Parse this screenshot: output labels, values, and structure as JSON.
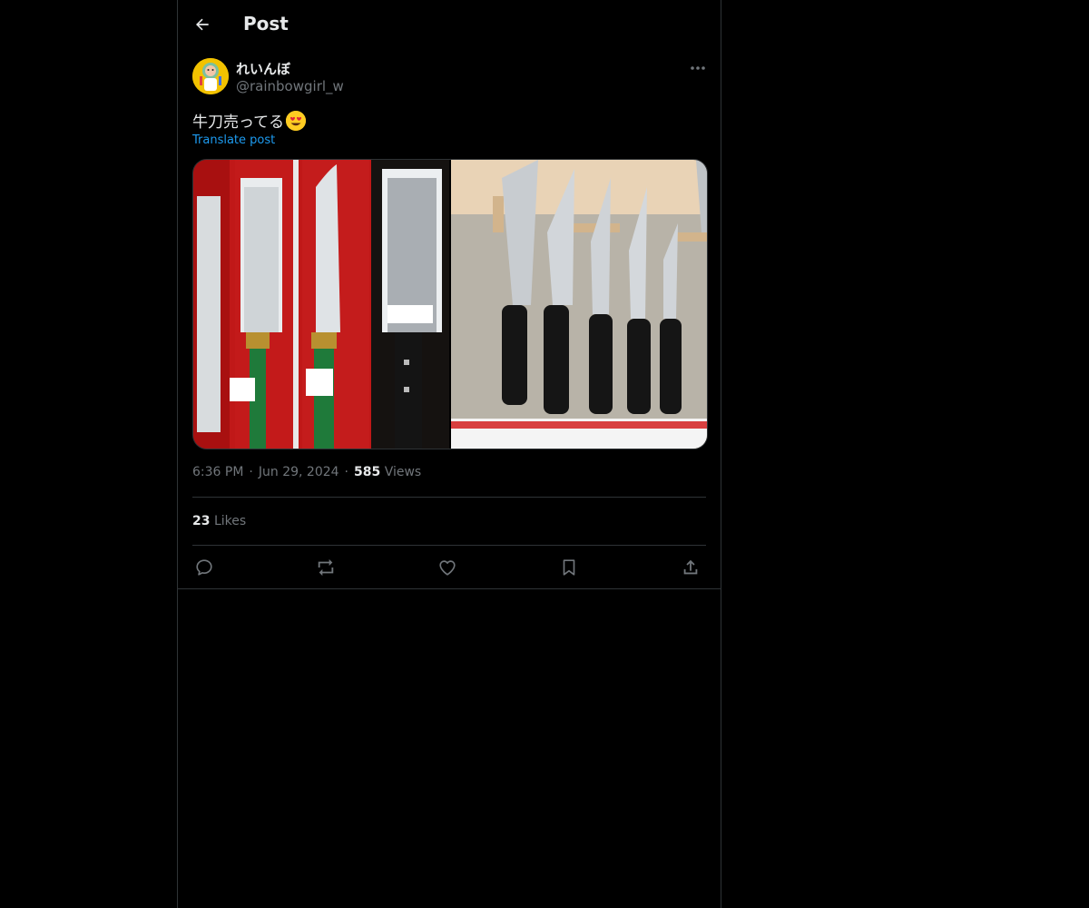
{
  "header": {
    "title": "Post",
    "back_icon": "arrow-left-icon"
  },
  "post": {
    "author": {
      "display_name": "れいんぼ",
      "handle": "@rainbowgirl_w",
      "avatar_color": "#f2c200"
    },
    "text": "牛刀売ってる",
    "emoji": "smiling-face-with-heart-eyes",
    "translate_label": "Translate post",
    "time": "6:36 PM",
    "date": "Jun 29, 2024",
    "views_count": "585",
    "views_label": "Views",
    "likes_count": "23",
    "likes_label": "Likes",
    "media": [
      {
        "description_icon": "knife-display-photo-1"
      },
      {
        "description_icon": "knife-display-photo-2"
      }
    ]
  },
  "actions": [
    {
      "icon": "reply-icon"
    },
    {
      "icon": "repost-icon"
    },
    {
      "icon": "like-icon"
    },
    {
      "icon": "bookmark-icon"
    },
    {
      "icon": "share-icon"
    }
  ],
  "colors": {
    "background": "#000000",
    "text": "#e7e9ea",
    "muted": "#71767b",
    "accent": "#1d9bf0",
    "border": "#2f3336"
  }
}
